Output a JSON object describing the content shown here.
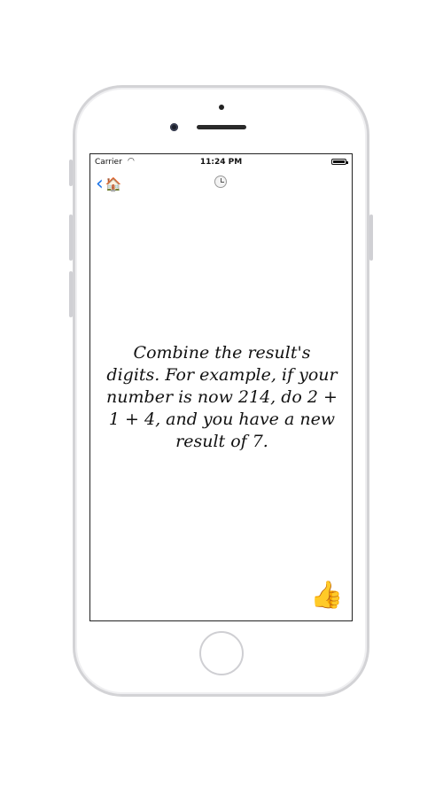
{
  "status_bar": {
    "carrier": "Carrier",
    "time": "11:24 PM"
  },
  "nav": {
    "back_label": "‹",
    "home_icon": "🏠"
  },
  "content": {
    "message": "Combine the result's digits. For example, if your number is now 214, do 2 + 1 + 4, and you have a new result of 7."
  },
  "actions": {
    "thumbs_up": "👍"
  },
  "colors": {
    "accent": "#1a73e8",
    "text": "#111111",
    "device_frame": "#d3d3d6"
  }
}
